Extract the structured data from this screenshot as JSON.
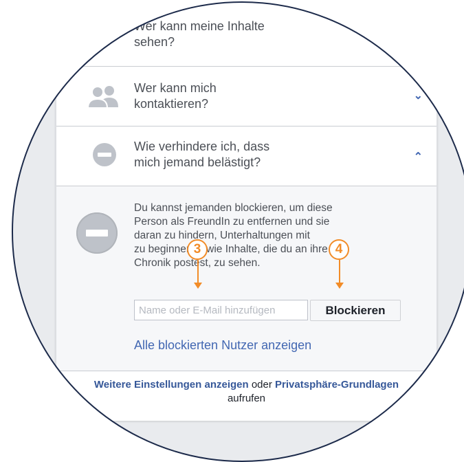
{
  "privacy": {
    "row1": {
      "line1": "Wer kann meine Inhalte",
      "line2": "sehen?"
    },
    "row2": {
      "line1": "Wer kann mich",
      "line2": "kontaktieren?",
      "icon": "people-icon",
      "chevron": "chevron-down-icon"
    },
    "row3": {
      "line1": "Wie verhindere ich, dass",
      "line2": "mich jemand belästigt?",
      "icon": "block-icon",
      "chevron": "chevron-up-icon"
    },
    "expanded": {
      "description": [
        "Du kannst jemanden blockieren, um diese",
        "Person als FreundIn zu entfernen und sie",
        "daran zu hindern, Unterhaltungen mit",
        "zu beginnen sowie Inhalte, die du an ihre",
        "Chronik postest, zu sehen."
      ],
      "input_placeholder": "Name oder E-Mail hinzufügen",
      "input_value": "",
      "block_button": "Blockieren",
      "all_blocked_link": "Alle blockierten Nutzer anzeigen"
    },
    "footer": {
      "link1": "Weitere Einstellungen anzeigen",
      "middle": "oder",
      "link2": "Privatsphäre-Grundlagen",
      "line2": "aufrufen"
    }
  },
  "callouts": [
    {
      "label": "3"
    },
    {
      "label": "4"
    }
  ],
  "colors": {
    "accent": "#4267b2",
    "callout": "#f28c28",
    "background": "#e9ebee"
  }
}
